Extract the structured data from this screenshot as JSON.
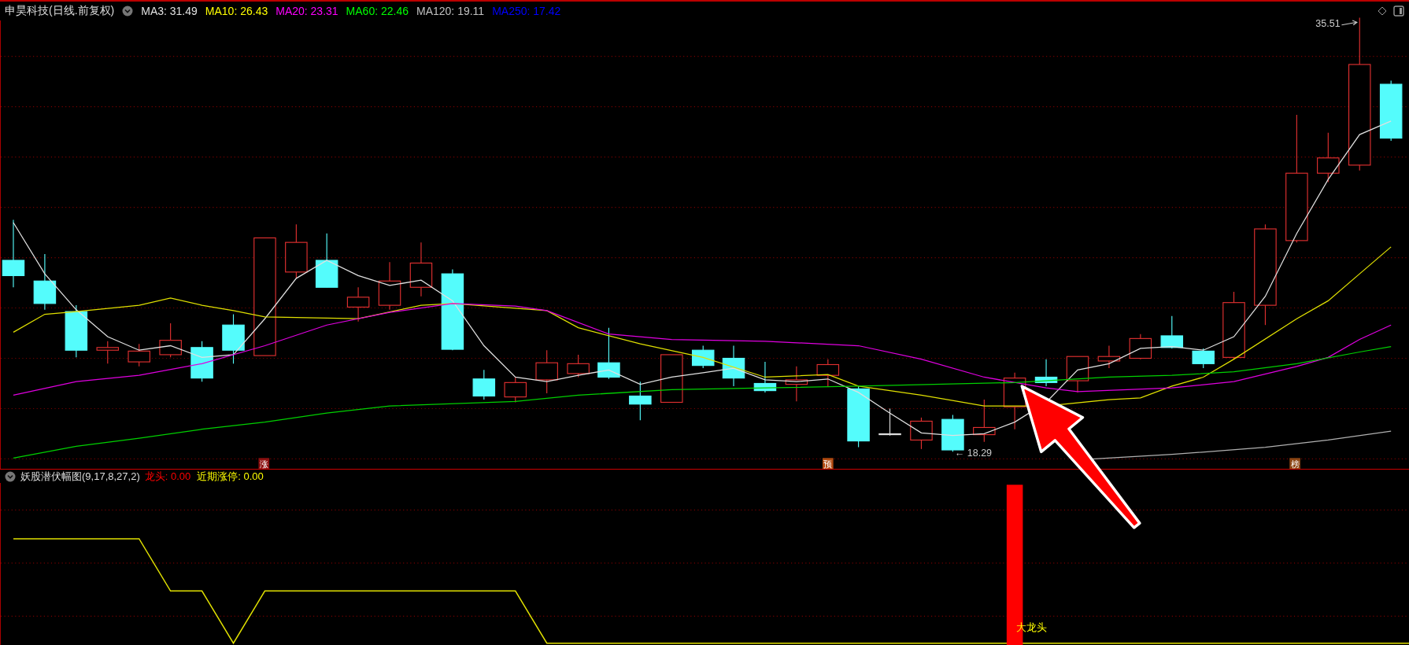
{
  "main_panel": {
    "title": "申昊科技(日线.前复权)",
    "indicators": [
      {
        "label": "MA3: 31.49",
        "color": "#e0e0e0"
      },
      {
        "label": "MA10: 26.43",
        "color": "#ffff00"
      },
      {
        "label": "MA20: 23.31",
        "color": "#ff00ff"
      },
      {
        "label": "MA60: 22.46",
        "color": "#00ff00"
      },
      {
        "label": "MA120: 19.11",
        "color": "#c0c0c0"
      },
      {
        "label": "MA250: 17.42",
        "color": "#0000ff"
      }
    ],
    "high_label": "35.51",
    "low_label": "← 18.29",
    "markers": [
      {
        "text": "涨",
        "color": "#8b1010"
      },
      {
        "text": "预",
        "color": "#b04a10"
      },
      {
        "text": "榜",
        "color": "#8b4513"
      }
    ]
  },
  "sub_panel": {
    "title": "妖股潜伏幅图(9,17,8,27,2)",
    "values": [
      {
        "label": "龙头: 0.00",
        "color": "#ff0000"
      },
      {
        "label": "近期涨停: 0.00",
        "color": "#ffff00"
      }
    ],
    "bar_label": "大龙头"
  }
}
